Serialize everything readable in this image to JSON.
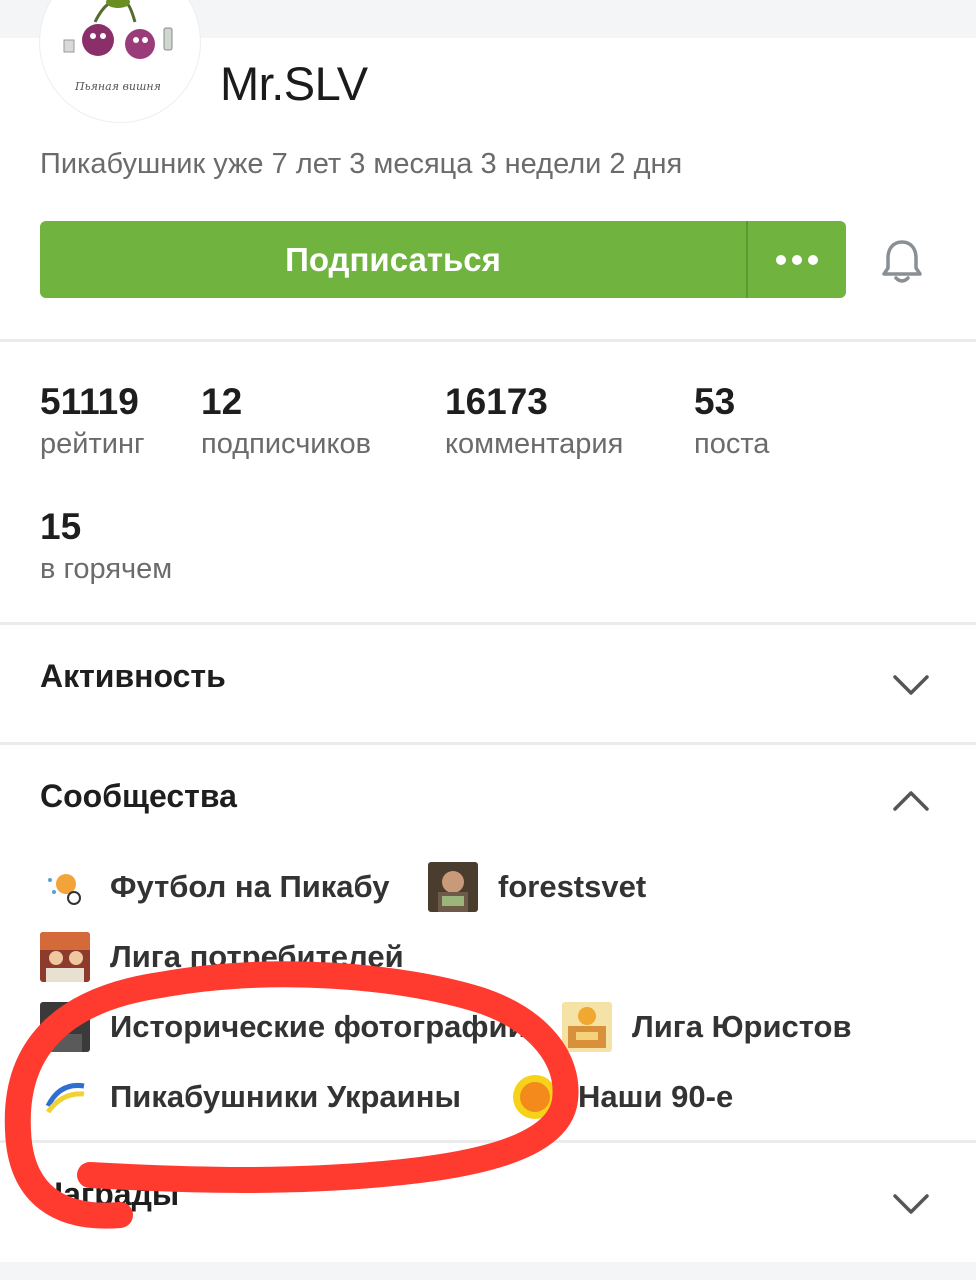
{
  "profile": {
    "username": "Mr.SLV",
    "since": "Пикабушник уже 7 лет 3 месяца 3 недели 2 дня",
    "avatar_caption": "Пьяная вишня"
  },
  "actions": {
    "subscribe_label": "Подписаться",
    "more_icon": "ellipsis-icon",
    "bell_icon": "bell-icon"
  },
  "stats": [
    {
      "value": "51119",
      "label": "рейтинг"
    },
    {
      "value": "12",
      "label": "подписчиков"
    },
    {
      "value": "16173",
      "label": "комментария"
    },
    {
      "value": "53",
      "label": "поста"
    },
    {
      "value": "15",
      "label": "в горячем"
    }
  ],
  "sections": {
    "activity": {
      "title": "Активность",
      "state": "collapsed"
    },
    "communities": {
      "title": "Сообщества",
      "state": "expanded",
      "items": [
        {
          "name": "Футбол на Пикабу"
        },
        {
          "name": "forestsvet"
        },
        {
          "name": "Лига потребителей"
        },
        {
          "name": "Исторические фотографии"
        },
        {
          "name": "Лига Юристов"
        },
        {
          "name": "Пикабушники Украины"
        },
        {
          "name": "Наши 90-е"
        }
      ]
    },
    "awards": {
      "title": "Награды",
      "state": "collapsed"
    }
  },
  "colors": {
    "accent_green": "#70b33f",
    "annotation_red": "#ff3b30"
  }
}
